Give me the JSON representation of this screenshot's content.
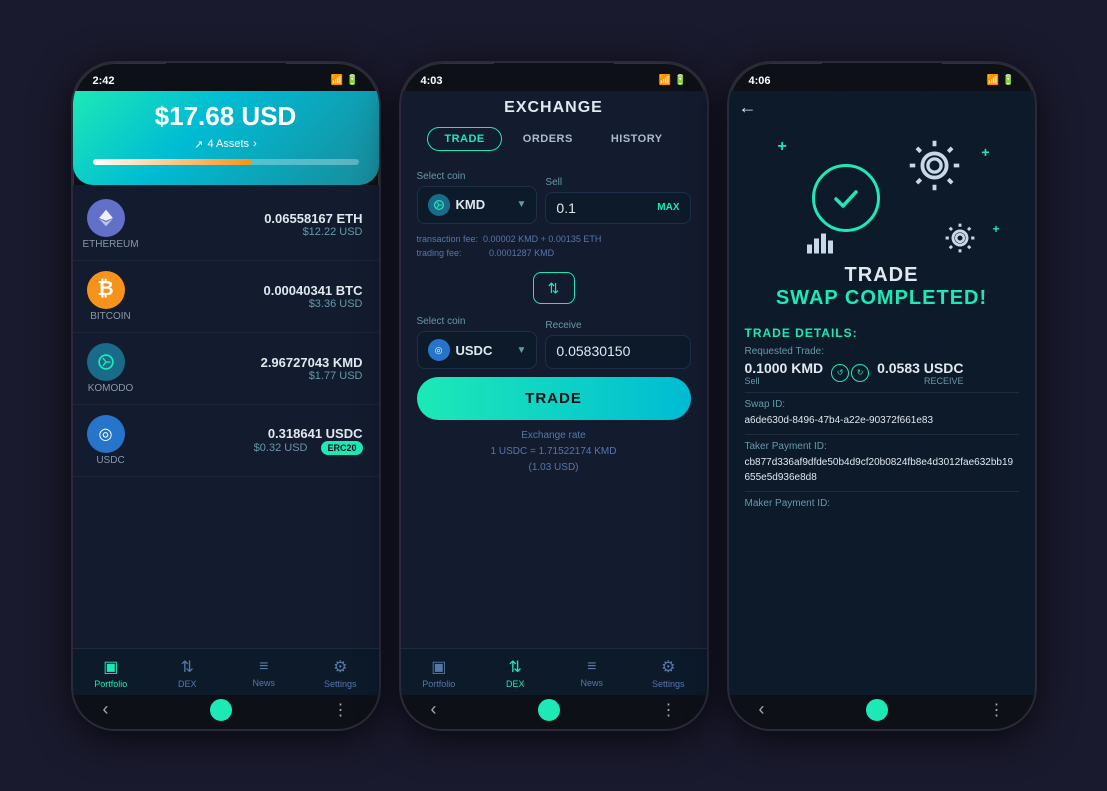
{
  "phone1": {
    "time": "2:42",
    "portfolio_amount": "$17.68 USD",
    "assets_link": "4 Assets",
    "progress_percent": 60,
    "progress_color2": "#f7931a",
    "assets": [
      {
        "name": "ETHEREUM",
        "symbol": "ETH",
        "crypto": "0.06558167 ETH",
        "usd": "$12.22 USD",
        "icon": "⬡",
        "bg": "#6270c8"
      },
      {
        "name": "BITCOIN",
        "symbol": "BTC",
        "crypto": "0.00040341 BTC",
        "usd": "$3.36 USD",
        "icon": "₿",
        "bg": "#f7931a"
      },
      {
        "name": "KOMODO",
        "symbol": "KMD",
        "crypto": "2.96727043 KMD",
        "usd": "$1.77 USD",
        "icon": "⚡",
        "bg": "#1a6b8a"
      },
      {
        "name": "USDC",
        "symbol": "USDC",
        "crypto": "0.318641 USDC",
        "usd": "$0.32 USD",
        "icon": "◎",
        "bg": "#2775ca",
        "badge": "ERC20"
      }
    ],
    "nav": [
      {
        "label": "Portfolio",
        "icon": "▣",
        "active": true
      },
      {
        "label": "DEX",
        "icon": "⇅",
        "active": false
      },
      {
        "label": "News",
        "icon": "≡",
        "active": false
      },
      {
        "label": "Settings",
        "icon": "⚙",
        "active": false
      }
    ]
  },
  "phone2": {
    "time": "4:03",
    "title": "EXCHANGE",
    "tabs": [
      "TRADE",
      "ORDERS",
      "HISTORY"
    ],
    "active_tab": "TRADE",
    "select_coin_label": "Select coin",
    "sell_label": "Sell",
    "sell_coin": "KMD",
    "sell_value": "0.1",
    "max_label": "MAX",
    "transaction_fee": "0.00002 KMD + 0.00135 ETH",
    "trading_fee": "0.0001287 KMD",
    "receive_label": "Receive",
    "receive_coin": "USDC",
    "receive_value": "0.05830150",
    "trade_button": "TRADE",
    "exchange_rate_line1": "Exchange rate",
    "exchange_rate_line2": "1 USDC = 1.71522174 KMD",
    "exchange_rate_line3": "(1.03 USD)",
    "nav": [
      {
        "label": "Portfolio",
        "icon": "▣",
        "active": false
      },
      {
        "label": "DEX",
        "icon": "⇅",
        "active": true
      },
      {
        "label": "News",
        "icon": "≡",
        "active": false
      },
      {
        "label": "Settings",
        "icon": "⚙",
        "active": false
      }
    ]
  },
  "phone3": {
    "time": "4:06",
    "title": "TRADE SWAP COMPLETED!",
    "trade_word": "TRADE",
    "swap_completed": "SWAP COMPLETED!",
    "trade_details_heading": "TRADE DETAILS:",
    "requested_trade_label": "Requested Trade:",
    "sell_amount": "0.1000 KMD",
    "sell_label": "Sell",
    "receive_amount": "0.0583 USDC",
    "receive_label": "RECEIVE",
    "swap_id_label": "Swap ID:",
    "swap_id": "a6de630d-8496-47b4-a22e-90372f661e83",
    "taker_payment_label": "Taker Payment ID:",
    "taker_payment_id": "cb877d336af9dfde50b4d9cf20b0824fb8e4d3012fae632bb19655e5d936e8d8",
    "maker_payment_label": "Maker Payment ID:"
  }
}
